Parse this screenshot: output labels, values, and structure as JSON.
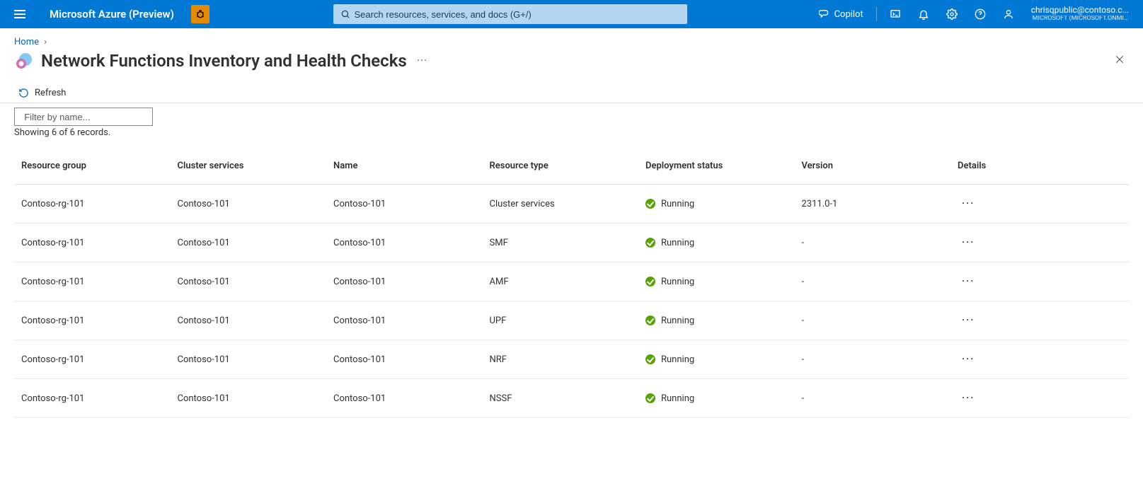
{
  "header": {
    "brand": "Microsoft Azure (Preview)",
    "search_placeholder": "Search resources, services, and docs (G+/)",
    "copilot_label": "Copilot",
    "account_user": "chrisqpublic@contoso.c...",
    "account_tenant": "MICROSOFT (MICROSOFT.ONMI..."
  },
  "breadcrumb": {
    "home_label": "Home"
  },
  "page": {
    "title": "Network Functions Inventory and Health Checks",
    "ellipsis": "···"
  },
  "toolbar": {
    "refresh_label": "Refresh"
  },
  "filter": {
    "placeholder": "Filter by name...",
    "record_count": "Showing 6 of 6 records."
  },
  "table": {
    "columns": {
      "resource_group": "Resource group",
      "cluster_services": "Cluster services",
      "name": "Name",
      "resource_type": "Resource type",
      "deployment_status": "Deployment status",
      "version": "Version",
      "details": "Details"
    },
    "rows": [
      {
        "resource_group": "Contoso-rg-101",
        "cluster_services": "Contoso-101",
        "name": "Contoso-101",
        "resource_type": "Cluster services",
        "deployment_status": "Running",
        "version": "2311.0-1"
      },
      {
        "resource_group": "Contoso-rg-101",
        "cluster_services": "Contoso-101",
        "name": "Contoso-101",
        "resource_type": "SMF",
        "deployment_status": "Running",
        "version": "-"
      },
      {
        "resource_group": "Contoso-rg-101",
        "cluster_services": "Contoso-101",
        "name": "Contoso-101",
        "resource_type": "AMF",
        "deployment_status": "Running",
        "version": "-"
      },
      {
        "resource_group": "Contoso-rg-101",
        "cluster_services": "Contoso-101",
        "name": "Contoso-101",
        "resource_type": "UPF",
        "deployment_status": "Running",
        "version": "-"
      },
      {
        "resource_group": "Contoso-rg-101",
        "cluster_services": "Contoso-101",
        "name": "Contoso-101",
        "resource_type": "NRF",
        "deployment_status": "Running",
        "version": "-"
      },
      {
        "resource_group": "Contoso-rg-101",
        "cluster_services": "Contoso-101",
        "name": "Contoso-101",
        "resource_type": "NSSF",
        "deployment_status": "Running",
        "version": "-"
      }
    ]
  }
}
